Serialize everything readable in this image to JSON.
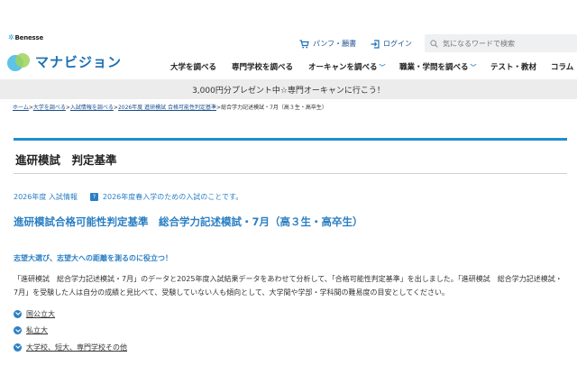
{
  "header": {
    "brand": "Benesse",
    "site_name": "マナビジョン",
    "pamphlet_label": "パンフ・願書",
    "login_label": "ログイン",
    "search_placeholder": "気になるワードで検索",
    "nav": [
      {
        "label": "大学を調べる",
        "has_menu": false
      },
      {
        "label": "専門学校を調べる",
        "has_menu": false
      },
      {
        "label": "オーキャンを調べる",
        "has_menu": true
      },
      {
        "label": "職業・学問を調べる",
        "has_menu": true
      },
      {
        "label": "テスト・教材",
        "has_menu": false
      },
      {
        "label": "コラム",
        "has_menu": false
      }
    ]
  },
  "promo": "3,000円分プレゼント中☆専門オーキャンに行こう！",
  "breadcrumb": {
    "items": [
      "ホーム",
      "大学を調べる",
      "入試情報を調べる",
      "2026年度 進研模試 合格可能性判定基準"
    ],
    "current": "総合学力記述模試・7月（高３生・高卒生）",
    "separator": ">"
  },
  "main": {
    "page_title": "進研模試　判定基準",
    "year_info": "2026年度 入試情報",
    "badge": "?",
    "year_note": "2026年度春入学のための入試のことです。",
    "sub_title": "進研模試合格可能性判定基準　総合学力記述模試・7月（高３生・高卒生）",
    "lead": "志望大選び、志望大への距離を測るのに役立つ！",
    "body": "「進研模試　総合学力記述模試・7月」のデータと2025年度入試結果データをあわせて分析して、「合格可能性判定基準」を出しました。「進研模試　総合学力記述模試・7月」を受験した人は自分の成績と見比べて、受験していない人も傾向として、大学間や学部・学科間の難易度の目安としてください。",
    "links": [
      "国公立大",
      "私立大",
      "大学校、短大、専門学校その他"
    ]
  },
  "colors": {
    "accent": "#2b7fc4",
    "title_rule": "#1f8fd0",
    "promo_bg": "#ececec"
  }
}
